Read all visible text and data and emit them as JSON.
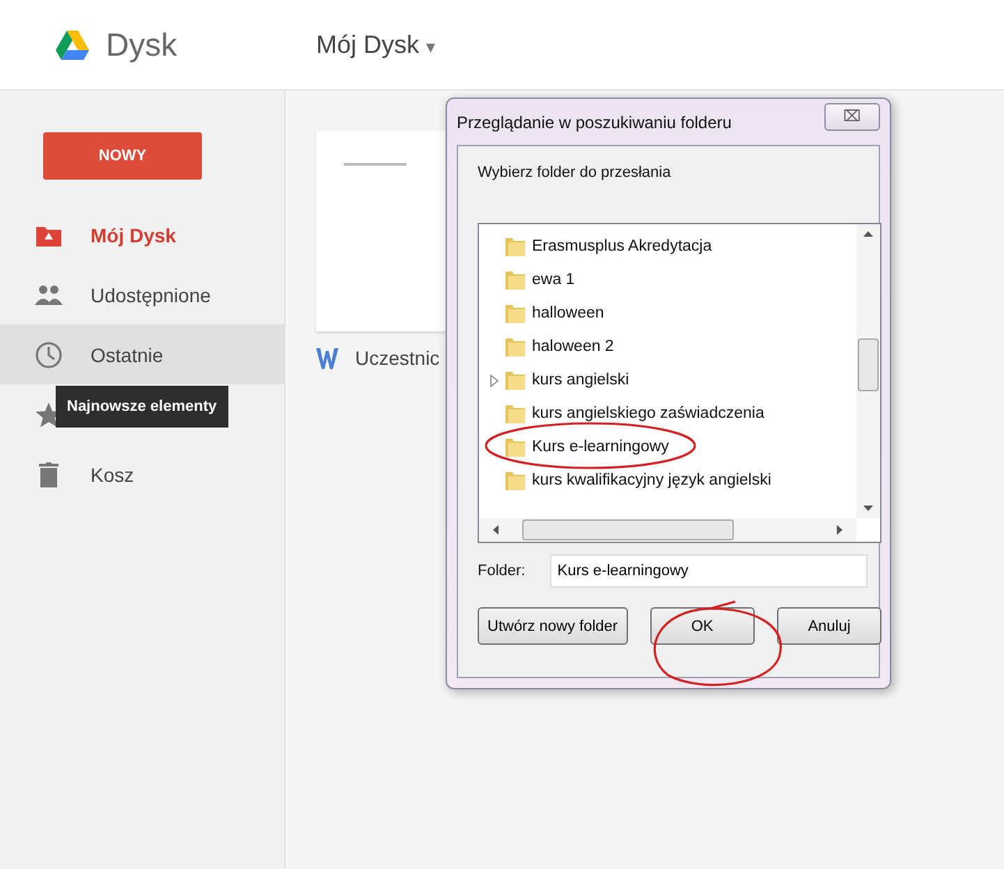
{
  "header": {
    "app_name": "Dysk",
    "location": "Mój Dysk",
    "location_caret": "▾"
  },
  "sidebar": {
    "new_button": "NOWY",
    "items": [
      {
        "label": "Mój Dysk",
        "selected": true,
        "hovered": false
      },
      {
        "label": "Udostępnione",
        "selected": false,
        "hovered": false
      },
      {
        "label": "Ostatnie",
        "selected": false,
        "hovered": true
      },
      {
        "label": "Kosz",
        "selected": false,
        "hovered": false
      }
    ],
    "tooltip": "Najnowsze elementy"
  },
  "files": [
    {
      "name": "Uczestnic"
    }
  ],
  "dialog": {
    "title": "Przeglądanie w poszukiwaniu folderu",
    "close": "⌧",
    "instruction": "Wybierz folder do przesłania",
    "folders": [
      {
        "name": "Erasmusplus Akredytacja",
        "expandable": false,
        "selected": false
      },
      {
        "name": "ewa 1",
        "expandable": false,
        "selected": false
      },
      {
        "name": "halloween",
        "expandable": false,
        "selected": false
      },
      {
        "name": "haloween 2",
        "expandable": false,
        "selected": false
      },
      {
        "name": "kurs angielski",
        "expandable": true,
        "selected": false
      },
      {
        "name": "kurs angielskiego zaświadczenia",
        "expandable": false,
        "selected": false
      },
      {
        "name": "Kurs e-learningowy",
        "expandable": false,
        "selected": false
      },
      {
        "name": "kurs kwalifikacyjny język angielski",
        "expandable": false,
        "selected": false
      }
    ],
    "folder_label": "Folder:",
    "folder_value": "Kurs e-learningowy",
    "buttons": [
      {
        "label": "Utwórz nowy folder",
        "kind": "wide"
      },
      {
        "label": "OK",
        "kind": "normal"
      },
      {
        "label": "Anuluj",
        "kind": "normal"
      }
    ]
  }
}
